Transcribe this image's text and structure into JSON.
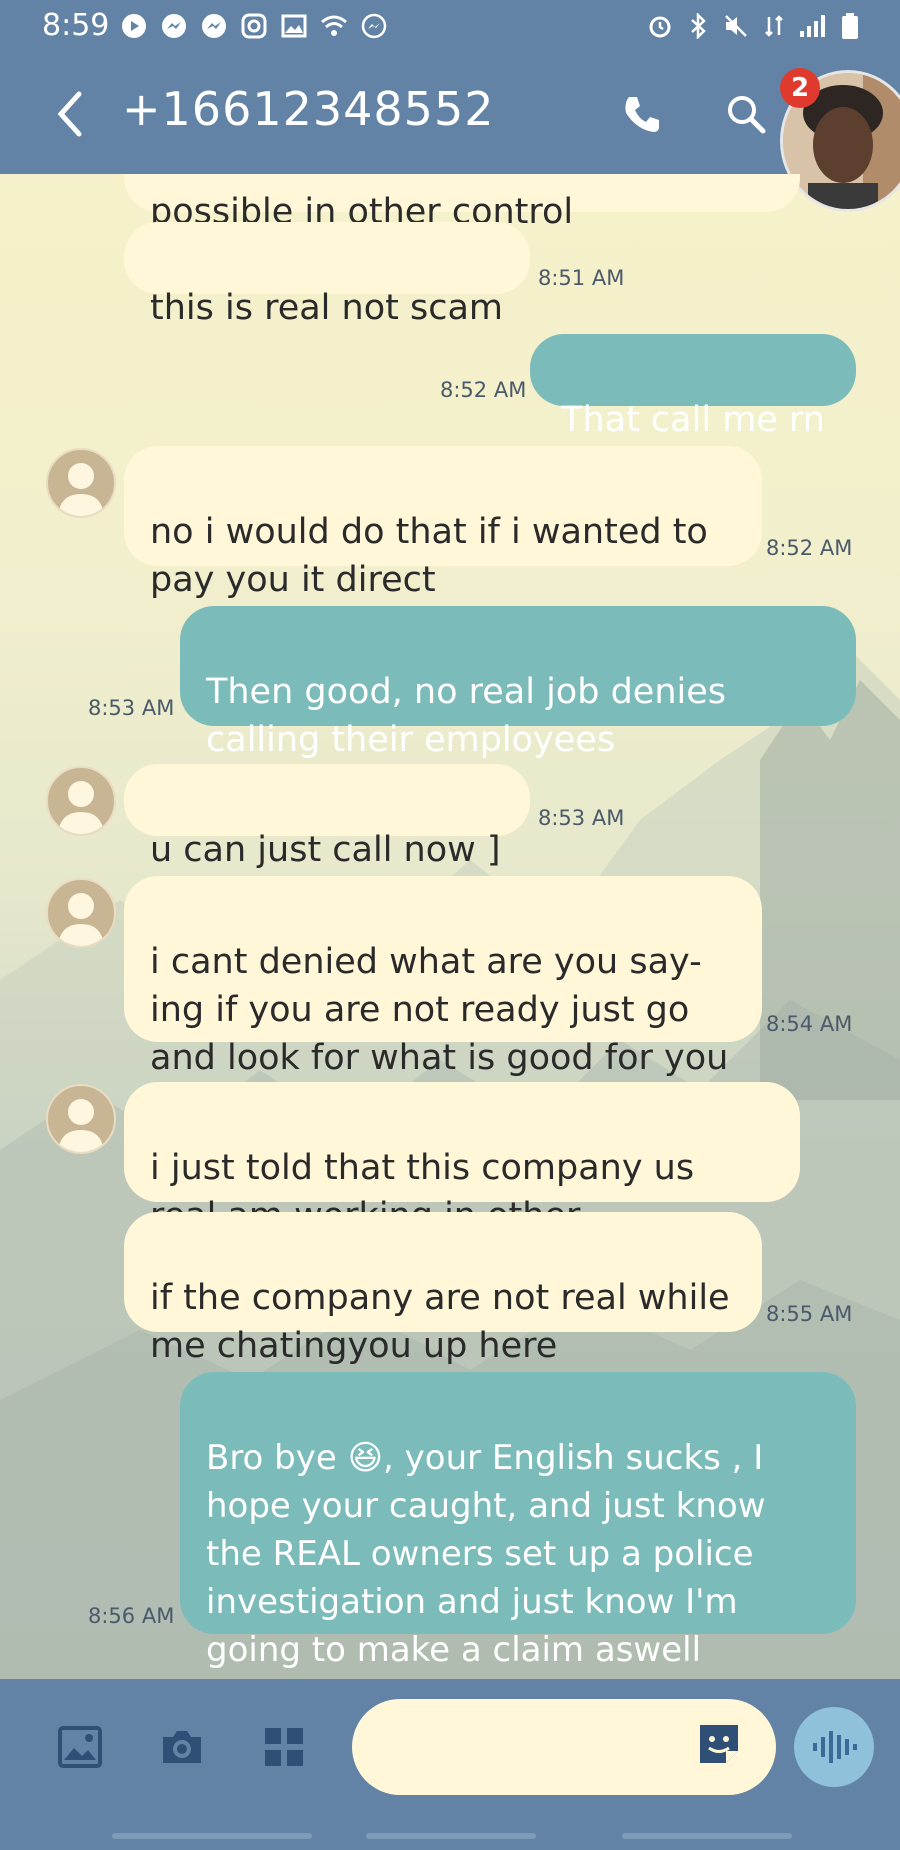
{
  "status_bar": {
    "time": "8:59"
  },
  "header": {
    "title": "+16612348552",
    "notification_count": "2"
  },
  "messages": [
    {
      "direction": "in",
      "text": "possible in other control",
      "time": ""
    },
    {
      "direction": "in",
      "text": "this is real not scam",
      "time": "8:51 AM"
    },
    {
      "direction": "out",
      "text": "That call me rn",
      "time": "8:52 AM"
    },
    {
      "direction": "in",
      "text": "no i would do that if i wanted to\npay you it direct",
      "time": "8:52 AM"
    },
    {
      "direction": "out",
      "text": "Then good,  no real job denies\ncalling their employees",
      "time": "8:53 AM"
    },
    {
      "direction": "in",
      "text": "u can just call now ]",
      "time": "8:53 AM"
    },
    {
      "direction": "in",
      "text": "i cant denied what are you say-\ning if you are not ready just go\nand look for what is good for you",
      "time": "8:54 AM"
    },
    {
      "direction": "in",
      "text": "i just told that this company us\nreal am working in other",
      "time": ""
    },
    {
      "direction": "in",
      "text": "if the company are not real while\nme chatingyou up here",
      "time": "8:55 AM"
    },
    {
      "direction": "out",
      "text": "Bro bye 😆, your English sucks , I\nhope your caught, and  just know\nthe REAL owners set up a police\ninvestigation and just know I'm\ngoing to make a claim aswell",
      "time": "8:56 AM"
    }
  ],
  "composer": {
    "placeholder": ""
  },
  "colors": {
    "bar": "#6283a6",
    "incoming_bubble": "#fff7d8",
    "outgoing_bubble": "#7bbcbb",
    "badge": "#e03a2e"
  },
  "icons": {
    "status": [
      "youtube-icon",
      "messenger-icon",
      "messenger-icon",
      "instagram-icon",
      "gallery-icon",
      "wifi-icon",
      "messenger-icon",
      "alarm-icon",
      "bluetooth-icon",
      "mute-icon",
      "signal-icon",
      "battery-icon"
    ],
    "header": [
      "back-arrow-icon",
      "phone-icon",
      "search-icon"
    ],
    "composer": [
      "image-icon",
      "camera-icon",
      "apps-grid-icon",
      "sticker-icon",
      "voice-icon"
    ]
  }
}
